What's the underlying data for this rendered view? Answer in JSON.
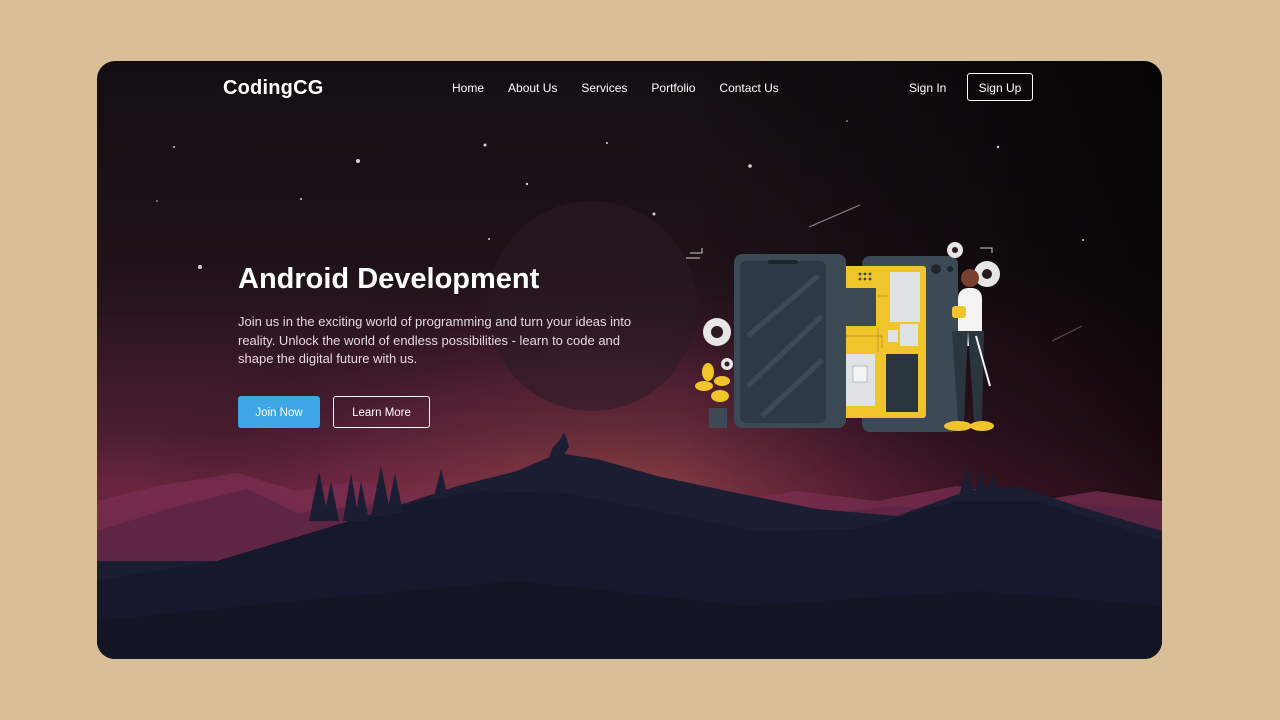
{
  "nav": {
    "brand": "CodingCG",
    "items": [
      {
        "label": "Home"
      },
      {
        "label": "About Us"
      },
      {
        "label": "Services"
      },
      {
        "label": "Portfolio"
      },
      {
        "label": "Contact Us"
      }
    ],
    "signin_label": "Sign In",
    "signup_label": "Sign Up"
  },
  "hero": {
    "title": "Android Development",
    "description": "Join us in the exciting world of programming and turn your ideas into reality. Unlock the world of endless possibilities - learn to code and shape the digital future with us.",
    "join_label": "Join Now",
    "learn_label": "Learn More"
  },
  "colors": {
    "page_bg": "#d8bf97",
    "accent_blue": "#3ea6e4",
    "illustration_yellow": "#f0c52c",
    "phone_slate": "#3b4a55"
  }
}
